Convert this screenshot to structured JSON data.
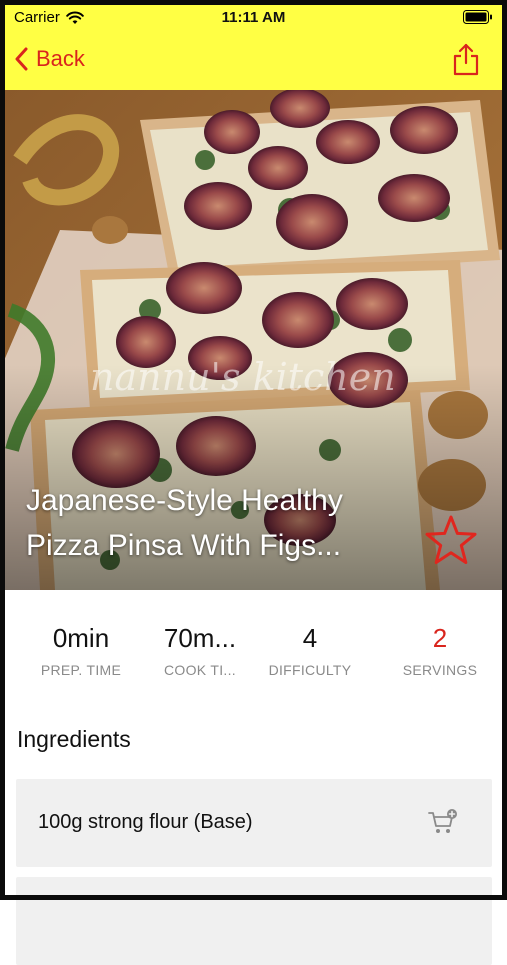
{
  "status_bar": {
    "carrier": "Carrier",
    "time": "11:11 AM"
  },
  "nav": {
    "back_label": "Back"
  },
  "hero": {
    "title_line1": "Japanese-Style Healthy",
    "title_line2": "Pizza Pinsa With Figs...",
    "watermark": "nannu's kitchen"
  },
  "stats": [
    {
      "value": "0min",
      "label": "PREP. TIME"
    },
    {
      "value": "70m...",
      "label": "COOK TI..."
    },
    {
      "value": "4",
      "label": "DIFFICULTY"
    },
    {
      "value": "2",
      "label": "SERVINGS"
    }
  ],
  "ingredients": {
    "heading": "Ingredients",
    "items": [
      {
        "text": "100g strong flour (Base)"
      },
      {
        "text": ""
      }
    ]
  },
  "colors": {
    "nav_bar": "#ffff44",
    "accent": "#d9251d"
  },
  "icons": {
    "back": "chevron-left-icon",
    "share": "share-icon",
    "favorite": "star-outline-icon",
    "cart": "cart-add-icon"
  }
}
